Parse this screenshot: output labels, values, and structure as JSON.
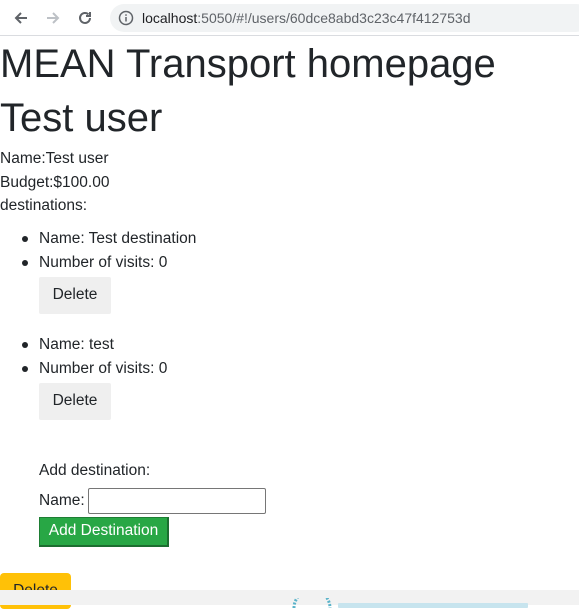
{
  "browser": {
    "url_host": "localhost",
    "url_path": ":5050/#!/users/60dce8abd3c23c47f412753d",
    "back_icon": "arrow-left-icon",
    "forward_icon": "arrow-right-icon",
    "reload_icon": "reload-icon",
    "info_icon": "info-icon"
  },
  "page": {
    "title": "MEAN Transport homepage",
    "user_heading": "Test user",
    "name_line": "Name:Test user",
    "budget_line": "Budget:$100.00",
    "destinations_label": "destinations:"
  },
  "destinations": [
    {
      "name_line": "Name: Test destination",
      "visits_line": "Number of visits: 0",
      "delete_label": "Delete"
    },
    {
      "name_line": "Name: test",
      "visits_line": "Number of visits: 0",
      "delete_label": "Delete"
    }
  ],
  "add_form": {
    "heading": "Add destination:",
    "name_label": "Name:",
    "name_value": "",
    "button_label": "Add Destination"
  },
  "user_actions": {
    "delete_label": "Delete"
  },
  "colors": {
    "add_button": "#28a745",
    "delete_user_button": "#ffc107",
    "delete_destination_button": "#efefef"
  }
}
